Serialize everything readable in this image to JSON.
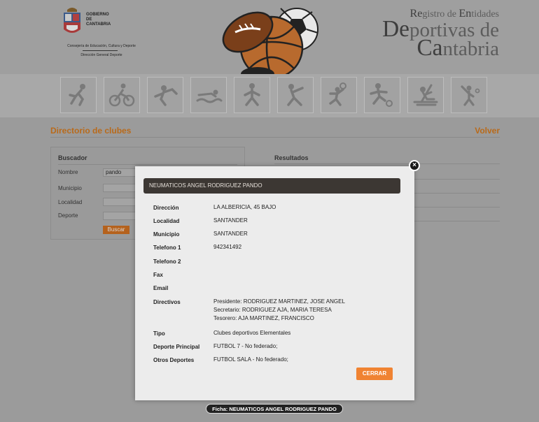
{
  "header": {
    "gov_name_lines": [
      "GOBIERNO",
      "DE",
      "CANTABRIA"
    ],
    "gov_line1": "Consejería de Educación, Cultura y Deporte",
    "gov_line2": "Dirección General Deporte",
    "title_l1": "Registro de Entidades",
    "title_l2": "Deportivas de",
    "title_l3": "Cantabria",
    "sports_icons": [
      "running-icon",
      "cycling-icon",
      "climbing-icon",
      "swimming-icon",
      "athletics-icon",
      "gymnastics-icon",
      "volleyball-icon",
      "football-icon",
      "rowing-icon",
      "tennis-icon"
    ]
  },
  "main": {
    "section_title": "Directorio de clubes",
    "back_link": "Volver",
    "search": {
      "title": "Buscador",
      "fields": [
        {
          "label": "Nombre",
          "value": "pando"
        },
        {
          "label": "Municipio",
          "value": ""
        },
        {
          "label": "Localidad",
          "value": ""
        },
        {
          "label": "Deporte",
          "value": ""
        }
      ],
      "button": "Buscar"
    },
    "results_title": "Resultados"
  },
  "modal": {
    "title": "NEUMATICOS ANGEL RODRIGUEZ PANDO",
    "rows": [
      {
        "label": "Dirección",
        "value": [
          "LA ALBERICIA, 45 BAJO"
        ]
      },
      {
        "label": "Localidad",
        "value": [
          "SANTANDER"
        ]
      },
      {
        "label": "Municipio",
        "value": [
          "SANTANDER"
        ]
      },
      {
        "label": "Telefono 1",
        "value": [
          "942341492"
        ]
      },
      {
        "label": "Telefono 2",
        "value": []
      },
      {
        "label": "Fax",
        "value": []
      },
      {
        "label": "Email",
        "value": []
      },
      {
        "label": "Directivos",
        "value": [
          "Presidente: RODRIGUEZ MARTINEZ, JOSE ANGEL",
          "Secretario: RODRIGUEZ AJA, MARIA TERESA",
          "Tesorero: AJA MARTINEZ, FRANCISCO"
        ]
      },
      {
        "label": "Tipo",
        "value": [
          "Clubes deportivos Elementales"
        ]
      },
      {
        "label": "Deporte Principal",
        "value": [
          "FUTBOL 7 - No federado;"
        ]
      },
      {
        "label": "Otros Deportes",
        "value": [
          "FUTBOL SALA - No federado;"
        ]
      }
    ],
    "close_button": "CERRAR",
    "close_icon": "close-icon",
    "caption": "Ficha: NEUMATICOS ANGEL RODRIGUEZ PANDO"
  },
  "colors": {
    "accent": "#f08332",
    "link": "#b96a1a",
    "modal_header": "#3c3733"
  }
}
